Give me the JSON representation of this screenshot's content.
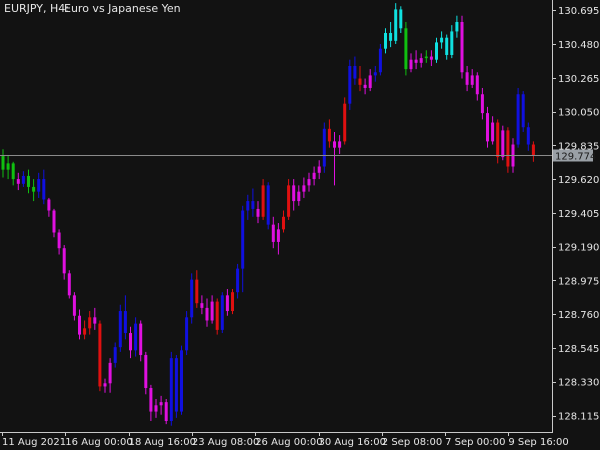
{
  "window": {
    "symbol": "EURJPY, H4:",
    "description": "Euro vs Japanese Yen"
  },
  "colors": {
    "background": "#121212",
    "axis_text": "#e6e6e6",
    "axis_line": "#c8c8c8",
    "current_price_line": "#8a8a8a",
    "current_price_tag": "#9aa0a6",
    "bull_strong": "#1010e0",
    "bear_strong": "#e01010",
    "bear_weak": "#e010e0",
    "bull_weak": "#10c010",
    "bull_fast": "#10e0e0"
  },
  "price_axis": {
    "labels": [
      "130.695",
      "130.480",
      "130.265",
      "130.050",
      "129.835",
      "129.620",
      "129.405",
      "129.190",
      "128.975",
      "128.760",
      "128.545",
      "128.330",
      "128.115"
    ],
    "current_price_label": "129.774"
  },
  "time_axis": {
    "labels": [
      "11 Aug 2021",
      "16 Aug 00:00",
      "18 Aug 16:00",
      "23 Aug 08:00",
      "26 Aug 00:00",
      "30 Aug 16:00",
      "2 Sep 08:00",
      "7 Sep 00:00",
      "9 Sep 16:00"
    ]
  },
  "chart_data": {
    "type": "candlestick",
    "title": "EURJPY, H4: Euro vs Japanese Yen",
    "ylim": [
      128.01,
      130.76
    ],
    "current_price": 129.774,
    "color_legend": {
      "B": "strong bull",
      "R": "strong bear",
      "M": "weak bear",
      "G": "weak bull",
      "C": "fast bull"
    },
    "candles": [
      {
        "o": 129.77,
        "h": 129.81,
        "l": 129.63,
        "c": 129.68,
        "k": "G"
      },
      {
        "o": 129.68,
        "h": 129.77,
        "l": 129.62,
        "c": 129.72,
        "k": "G"
      },
      {
        "o": 129.72,
        "h": 129.73,
        "l": 129.58,
        "c": 129.62,
        "k": "G"
      },
      {
        "o": 129.62,
        "h": 129.66,
        "l": 129.55,
        "c": 129.59,
        "k": "M"
      },
      {
        "o": 129.59,
        "h": 129.67,
        "l": 129.57,
        "c": 129.64,
        "k": "B"
      },
      {
        "o": 129.64,
        "h": 129.68,
        "l": 129.53,
        "c": 129.57,
        "k": "G"
      },
      {
        "o": 129.57,
        "h": 129.62,
        "l": 129.48,
        "c": 129.54,
        "k": "G"
      },
      {
        "o": 129.54,
        "h": 129.66,
        "l": 129.5,
        "c": 129.62,
        "k": "B"
      },
      {
        "o": 129.62,
        "h": 129.68,
        "l": 129.46,
        "c": 129.49,
        "k": "B"
      },
      {
        "o": 129.49,
        "h": 129.5,
        "l": 129.38,
        "c": 129.42,
        "k": "M"
      },
      {
        "o": 129.42,
        "h": 129.43,
        "l": 129.25,
        "c": 129.28,
        "k": "M"
      },
      {
        "o": 129.28,
        "h": 129.3,
        "l": 129.14,
        "c": 129.18,
        "k": "M"
      },
      {
        "o": 129.18,
        "h": 129.2,
        "l": 128.98,
        "c": 129.02,
        "k": "M"
      },
      {
        "o": 129.02,
        "h": 129.04,
        "l": 128.86,
        "c": 128.88,
        "k": "M"
      },
      {
        "o": 128.88,
        "h": 128.9,
        "l": 128.72,
        "c": 128.75,
        "k": "M"
      },
      {
        "o": 128.75,
        "h": 128.79,
        "l": 128.6,
        "c": 128.63,
        "k": "M"
      },
      {
        "o": 128.63,
        "h": 128.72,
        "l": 128.6,
        "c": 128.67,
        "k": "R"
      },
      {
        "o": 128.67,
        "h": 128.78,
        "l": 128.63,
        "c": 128.74,
        "k": "R"
      },
      {
        "o": 128.74,
        "h": 128.8,
        "l": 128.66,
        "c": 128.7,
        "k": "M"
      },
      {
        "o": 128.7,
        "h": 128.72,
        "l": 128.27,
        "c": 128.3,
        "k": "R"
      },
      {
        "o": 128.3,
        "h": 128.35,
        "l": 128.26,
        "c": 128.32,
        "k": "M"
      },
      {
        "o": 128.32,
        "h": 128.48,
        "l": 128.26,
        "c": 128.45,
        "k": "M"
      },
      {
        "o": 128.45,
        "h": 128.58,
        "l": 128.42,
        "c": 128.55,
        "k": "B"
      },
      {
        "o": 128.55,
        "h": 128.82,
        "l": 128.52,
        "c": 128.78,
        "k": "B"
      },
      {
        "o": 128.78,
        "h": 128.88,
        "l": 128.6,
        "c": 128.64,
        "k": "B"
      },
      {
        "o": 128.64,
        "h": 128.68,
        "l": 128.48,
        "c": 128.53,
        "k": "M"
      },
      {
        "o": 128.53,
        "h": 128.74,
        "l": 128.49,
        "c": 128.7,
        "k": "B"
      },
      {
        "o": 128.7,
        "h": 128.72,
        "l": 128.46,
        "c": 128.5,
        "k": "M"
      },
      {
        "o": 128.5,
        "h": 128.52,
        "l": 128.25,
        "c": 128.29,
        "k": "M"
      },
      {
        "o": 128.29,
        "h": 128.31,
        "l": 128.08,
        "c": 128.14,
        "k": "M"
      },
      {
        "o": 128.14,
        "h": 128.22,
        "l": 128.1,
        "c": 128.18,
        "k": "M"
      },
      {
        "o": 128.18,
        "h": 128.24,
        "l": 128.12,
        "c": 128.2,
        "k": "M"
      },
      {
        "o": 128.2,
        "h": 128.22,
        "l": 128.06,
        "c": 128.08,
        "k": "M"
      },
      {
        "o": 128.08,
        "h": 128.52,
        "l": 128.05,
        "c": 128.48,
        "k": "B"
      },
      {
        "o": 128.48,
        "h": 128.5,
        "l": 128.1,
        "c": 128.14,
        "k": "B"
      },
      {
        "o": 128.14,
        "h": 128.56,
        "l": 128.12,
        "c": 128.53,
        "k": "B"
      },
      {
        "o": 128.53,
        "h": 128.78,
        "l": 128.5,
        "c": 128.74,
        "k": "B"
      },
      {
        "o": 128.74,
        "h": 129.02,
        "l": 128.7,
        "c": 128.98,
        "k": "B"
      },
      {
        "o": 128.98,
        "h": 129.04,
        "l": 128.8,
        "c": 128.83,
        "k": "R"
      },
      {
        "o": 128.83,
        "h": 128.88,
        "l": 128.76,
        "c": 128.8,
        "k": "M"
      },
      {
        "o": 128.8,
        "h": 128.86,
        "l": 128.68,
        "c": 128.72,
        "k": "M"
      },
      {
        "o": 128.72,
        "h": 128.88,
        "l": 128.7,
        "c": 128.84,
        "k": "M"
      },
      {
        "o": 128.84,
        "h": 128.86,
        "l": 128.63,
        "c": 128.66,
        "k": "R"
      },
      {
        "o": 128.66,
        "h": 128.9,
        "l": 128.64,
        "c": 128.88,
        "k": "B"
      },
      {
        "o": 128.88,
        "h": 128.92,
        "l": 128.75,
        "c": 128.78,
        "k": "M"
      },
      {
        "o": 128.78,
        "h": 128.92,
        "l": 128.76,
        "c": 128.9,
        "k": "R"
      },
      {
        "o": 128.9,
        "h": 129.08,
        "l": 128.86,
        "c": 129.05,
        "k": "B"
      },
      {
        "o": 129.05,
        "h": 129.45,
        "l": 128.9,
        "c": 129.42,
        "k": "B"
      },
      {
        "o": 129.42,
        "h": 129.52,
        "l": 129.36,
        "c": 129.48,
        "k": "B"
      },
      {
        "o": 129.48,
        "h": 129.56,
        "l": 129.38,
        "c": 129.43,
        "k": "B"
      },
      {
        "o": 129.43,
        "h": 129.48,
        "l": 129.34,
        "c": 129.38,
        "k": "M"
      },
      {
        "o": 129.38,
        "h": 129.62,
        "l": 129.36,
        "c": 129.58,
        "k": "R"
      },
      {
        "o": 129.58,
        "h": 129.6,
        "l": 129.3,
        "c": 129.33,
        "k": "B"
      },
      {
        "o": 129.33,
        "h": 129.38,
        "l": 129.18,
        "c": 129.22,
        "k": "M"
      },
      {
        "o": 129.22,
        "h": 129.34,
        "l": 129.14,
        "c": 129.3,
        "k": "M"
      },
      {
        "o": 129.3,
        "h": 129.42,
        "l": 129.28,
        "c": 129.38,
        "k": "R"
      },
      {
        "o": 129.38,
        "h": 129.62,
        "l": 129.36,
        "c": 129.58,
        "k": "R"
      },
      {
        "o": 129.58,
        "h": 129.62,
        "l": 129.42,
        "c": 129.48,
        "k": "M"
      },
      {
        "o": 129.48,
        "h": 129.58,
        "l": 129.45,
        "c": 129.54,
        "k": "M"
      },
      {
        "o": 129.54,
        "h": 129.63,
        "l": 129.5,
        "c": 129.58,
        "k": "M"
      },
      {
        "o": 129.58,
        "h": 129.66,
        "l": 129.54,
        "c": 129.62,
        "k": "M"
      },
      {
        "o": 129.62,
        "h": 129.7,
        "l": 129.58,
        "c": 129.66,
        "k": "M"
      },
      {
        "o": 129.66,
        "h": 129.74,
        "l": 129.62,
        "c": 129.7,
        "k": "M"
      },
      {
        "o": 129.7,
        "h": 129.98,
        "l": 129.66,
        "c": 129.94,
        "k": "B"
      },
      {
        "o": 129.94,
        "h": 130.0,
        "l": 129.82,
        "c": 129.86,
        "k": "R"
      },
      {
        "o": 129.86,
        "h": 129.92,
        "l": 129.58,
        "c": 129.82,
        "k": "M"
      },
      {
        "o": 129.82,
        "h": 129.9,
        "l": 129.78,
        "c": 129.86,
        "k": "M"
      },
      {
        "o": 129.86,
        "h": 130.14,
        "l": 129.84,
        "c": 130.1,
        "k": "R"
      },
      {
        "o": 130.1,
        "h": 130.38,
        "l": 130.06,
        "c": 130.34,
        "k": "B"
      },
      {
        "o": 130.34,
        "h": 130.4,
        "l": 130.22,
        "c": 130.26,
        "k": "B"
      },
      {
        "o": 130.26,
        "h": 130.34,
        "l": 130.18,
        "c": 130.22,
        "k": "R"
      },
      {
        "o": 130.22,
        "h": 130.26,
        "l": 130.16,
        "c": 130.2,
        "k": "M"
      },
      {
        "o": 130.2,
        "h": 130.32,
        "l": 130.18,
        "c": 130.28,
        "k": "M"
      },
      {
        "o": 130.28,
        "h": 130.34,
        "l": 130.24,
        "c": 130.3,
        "k": "B"
      },
      {
        "o": 130.3,
        "h": 130.48,
        "l": 130.28,
        "c": 130.45,
        "k": "B"
      },
      {
        "o": 130.45,
        "h": 130.58,
        "l": 130.42,
        "c": 130.55,
        "k": "C"
      },
      {
        "o": 130.55,
        "h": 130.62,
        "l": 130.46,
        "c": 130.5,
        "k": "C"
      },
      {
        "o": 130.5,
        "h": 130.74,
        "l": 130.48,
        "c": 130.7,
        "k": "C"
      },
      {
        "o": 130.7,
        "h": 130.72,
        "l": 130.55,
        "c": 130.58,
        "k": "C"
      },
      {
        "o": 130.58,
        "h": 130.62,
        "l": 130.28,
        "c": 130.32,
        "k": "G"
      },
      {
        "o": 130.32,
        "h": 130.42,
        "l": 130.3,
        "c": 130.38,
        "k": "M"
      },
      {
        "o": 130.38,
        "h": 130.44,
        "l": 130.32,
        "c": 130.36,
        "k": "M"
      },
      {
        "o": 130.36,
        "h": 130.42,
        "l": 130.33,
        "c": 130.39,
        "k": "M"
      },
      {
        "o": 130.39,
        "h": 130.44,
        "l": 130.36,
        "c": 130.4,
        "k": "G"
      },
      {
        "o": 130.4,
        "h": 130.44,
        "l": 130.34,
        "c": 130.38,
        "k": "M"
      },
      {
        "o": 130.38,
        "h": 130.52,
        "l": 130.36,
        "c": 130.49,
        "k": "C"
      },
      {
        "o": 130.49,
        "h": 130.56,
        "l": 130.45,
        "c": 130.52,
        "k": "C"
      },
      {
        "o": 130.52,
        "h": 130.54,
        "l": 130.38,
        "c": 130.41,
        "k": "C"
      },
      {
        "o": 130.41,
        "h": 130.6,
        "l": 130.39,
        "c": 130.56,
        "k": "C"
      },
      {
        "o": 130.56,
        "h": 130.66,
        "l": 130.52,
        "c": 130.62,
        "k": "C"
      },
      {
        "o": 130.62,
        "h": 130.66,
        "l": 130.26,
        "c": 130.3,
        "k": "M"
      },
      {
        "o": 130.3,
        "h": 130.34,
        "l": 130.18,
        "c": 130.22,
        "k": "M"
      },
      {
        "o": 130.22,
        "h": 130.32,
        "l": 130.2,
        "c": 130.28,
        "k": "M"
      },
      {
        "o": 130.28,
        "h": 130.3,
        "l": 130.12,
        "c": 130.16,
        "k": "M"
      },
      {
        "o": 130.16,
        "h": 130.2,
        "l": 130.0,
        "c": 130.04,
        "k": "M"
      },
      {
        "o": 130.04,
        "h": 130.08,
        "l": 129.82,
        "c": 129.86,
        "k": "M"
      },
      {
        "o": 129.86,
        "h": 130.02,
        "l": 129.84,
        "c": 129.98,
        "k": "M"
      },
      {
        "o": 129.98,
        "h": 130.0,
        "l": 129.72,
        "c": 129.76,
        "k": "R"
      },
      {
        "o": 129.76,
        "h": 129.96,
        "l": 129.74,
        "c": 129.93,
        "k": "M"
      },
      {
        "o": 129.93,
        "h": 129.95,
        "l": 129.66,
        "c": 129.7,
        "k": "R"
      },
      {
        "o": 129.7,
        "h": 129.88,
        "l": 129.66,
        "c": 129.84,
        "k": "M"
      },
      {
        "o": 129.84,
        "h": 130.2,
        "l": 129.82,
        "c": 130.16,
        "k": "B"
      },
      {
        "o": 130.16,
        "h": 130.18,
        "l": 129.92,
        "c": 129.95,
        "k": "B"
      },
      {
        "o": 129.95,
        "h": 129.98,
        "l": 129.8,
        "c": 129.84,
        "k": "B"
      },
      {
        "o": 129.84,
        "h": 129.86,
        "l": 129.73,
        "c": 129.77,
        "k": "R"
      }
    ]
  }
}
